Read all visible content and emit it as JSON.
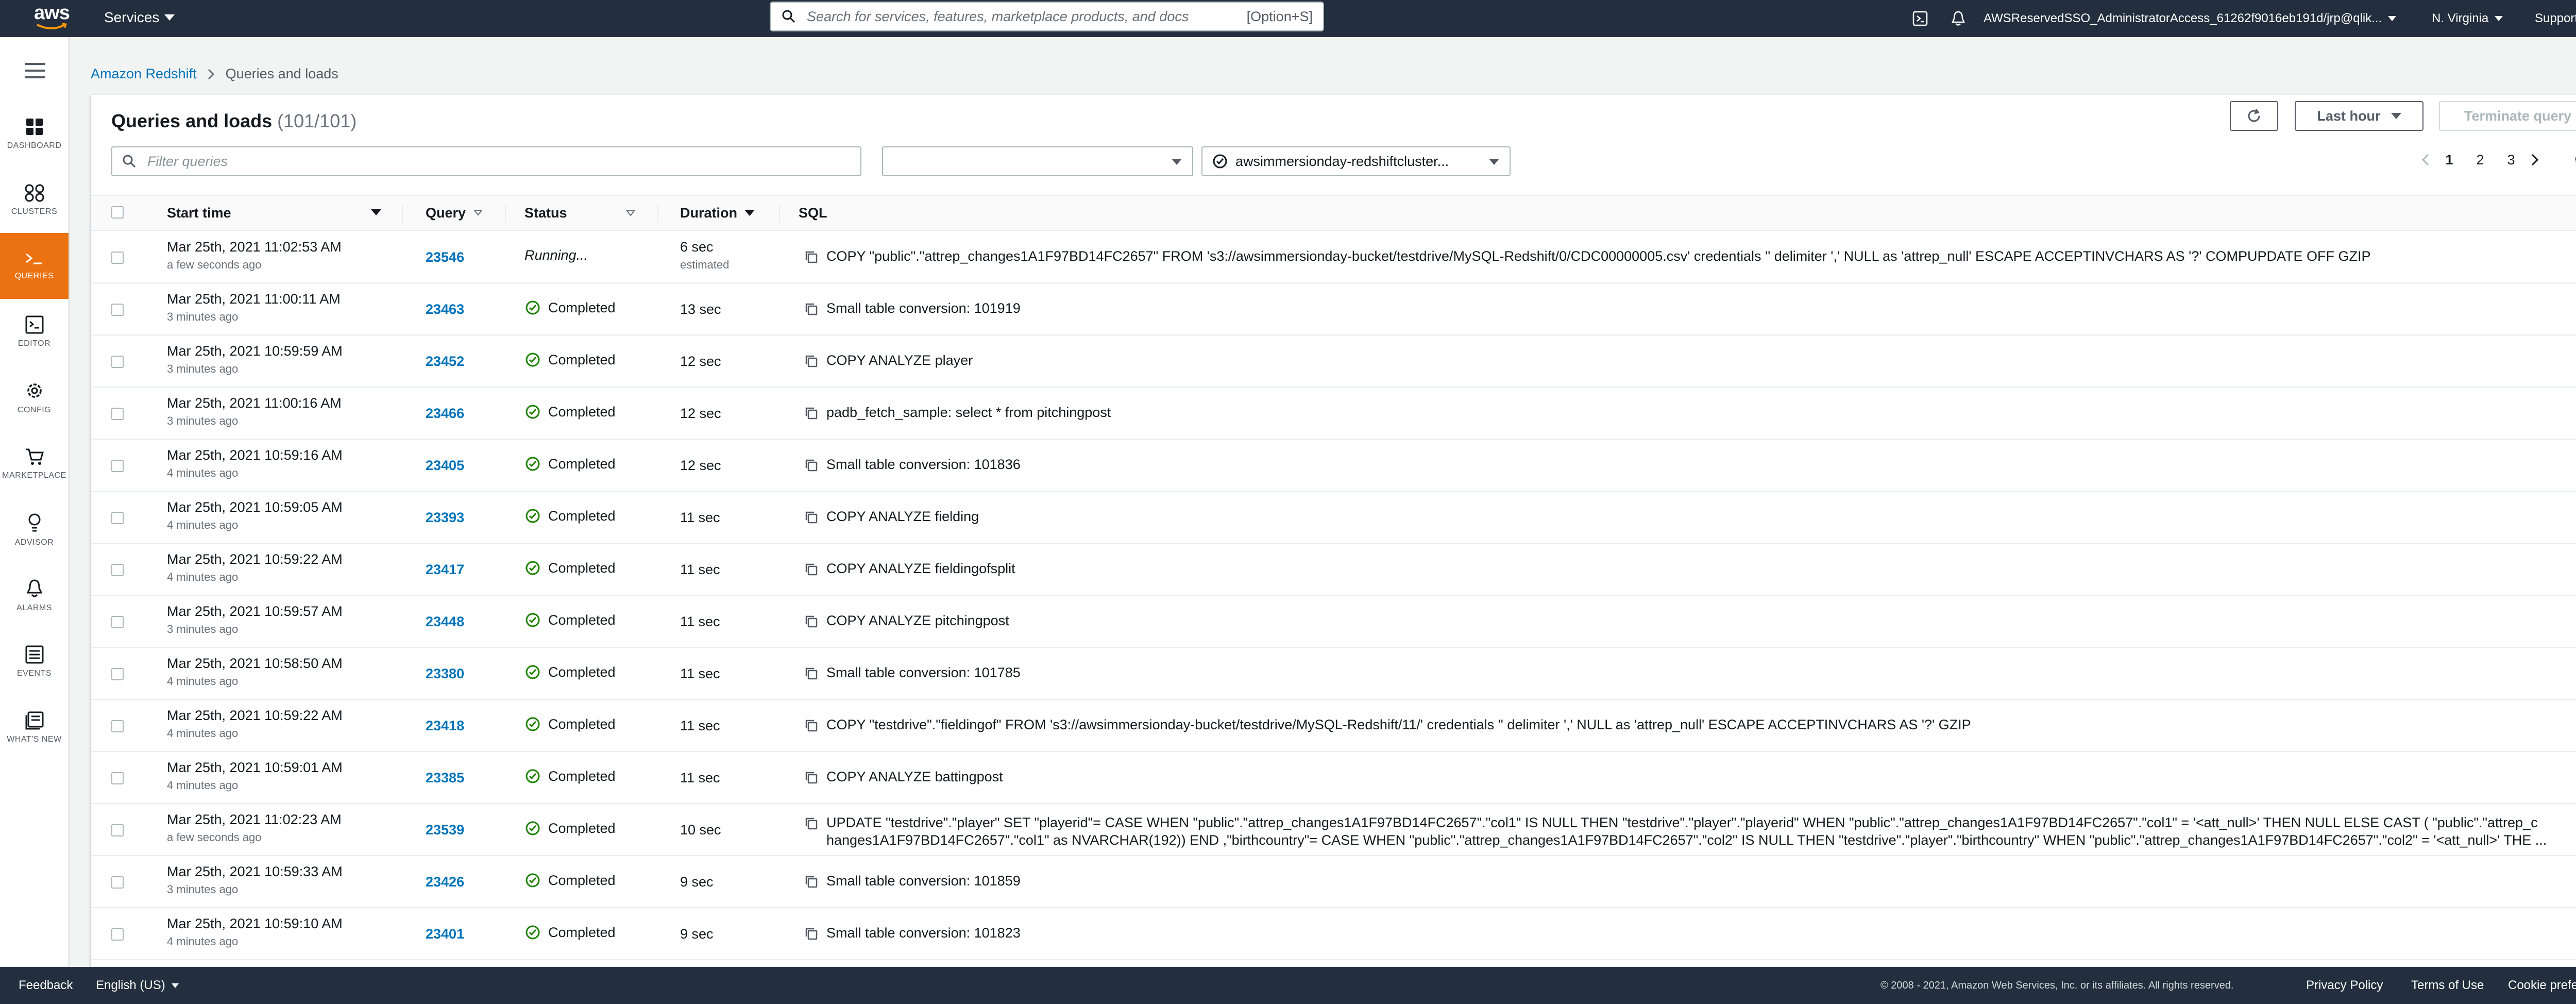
{
  "topnav": {
    "logo_text": "aws",
    "services_label": "Services",
    "search_placeholder": "Search for services, features, marketplace products, and docs",
    "search_shortcut": "[Option+S]",
    "account": "AWSReservedSSO_AdministratorAccess_61262f9016eb191d/jrp@qlik...",
    "region": "N. Virginia",
    "support": "Support"
  },
  "sidebar": {
    "items": [
      {
        "label": "DASHBOARD",
        "icon": "dashboard-icon"
      },
      {
        "label": "CLUSTERS",
        "icon": "clusters-icon"
      },
      {
        "label": "QUERIES",
        "icon": "queries-icon",
        "active": true
      },
      {
        "label": "EDITOR",
        "icon": "editor-icon"
      },
      {
        "label": "CONFIG",
        "icon": "config-gear-icon"
      },
      {
        "label": "MARKETPLACE",
        "icon": "marketplace-icon"
      },
      {
        "label": "ADVISOR",
        "icon": "advisor-lightbulb-icon"
      },
      {
        "label": "ALARMS",
        "icon": "alarms-bell-icon"
      },
      {
        "label": "EVENTS",
        "icon": "events-icon"
      },
      {
        "label": "WHAT'S NEW",
        "icon": "whats-new-icon"
      }
    ]
  },
  "breadcrumb": {
    "root": "Amazon Redshift",
    "current": "Queries and loads"
  },
  "panel": {
    "title": "Queries and loads",
    "count": "(101/101)",
    "time_range": "Last hour",
    "terminate_label": "Terminate query",
    "filter_placeholder": "Filter queries",
    "filter_select_value": "",
    "cluster_value": "awsimmersionday-redshiftcluster...",
    "pages": [
      "1",
      "2",
      "3"
    ],
    "current_page": "1"
  },
  "table": {
    "columns": {
      "start_time": "Start time",
      "query": "Query",
      "status": "Status",
      "duration": "Duration",
      "sql": "SQL"
    },
    "rows": [
      {
        "start": "Mar 25th, 2021 11:02:53 AM",
        "ago": "a few seconds ago",
        "query": "23546",
        "status": "Running...",
        "running": true,
        "duration": "6 sec",
        "duration_note": "estimated",
        "sql": "COPY \"public\".\"attrep_changes1A1F97BD14FC2657\" FROM 's3://awsimmersionday-bucket/testdrive/MySQL-Redshift/0/CDC00000005.csv' credentials '' delimiter ',' NULL as 'attrep_null' ESCAPE ACCEPTINVCHARS AS '?' COMPUPDATE OFF GZIP"
      },
      {
        "start": "Mar 25th, 2021 11:00:11 AM",
        "ago": "3 minutes ago",
        "query": "23463",
        "status": "Completed",
        "duration": "13 sec",
        "sql": "Small table conversion: 101919"
      },
      {
        "start": "Mar 25th, 2021 10:59:59 AM",
        "ago": "3 minutes ago",
        "query": "23452",
        "status": "Completed",
        "duration": "12 sec",
        "sql": "COPY ANALYZE player"
      },
      {
        "start": "Mar 25th, 2021 11:00:16 AM",
        "ago": "3 minutes ago",
        "query": "23466",
        "status": "Completed",
        "duration": "12 sec",
        "sql": "padb_fetch_sample: select * from pitchingpost"
      },
      {
        "start": "Mar 25th, 2021 10:59:16 AM",
        "ago": "4 minutes ago",
        "query": "23405",
        "status": "Completed",
        "duration": "12 sec",
        "sql": "Small table conversion: 101836"
      },
      {
        "start": "Mar 25th, 2021 10:59:05 AM",
        "ago": "4 minutes ago",
        "query": "23393",
        "status": "Completed",
        "duration": "11 sec",
        "sql": "COPY ANALYZE fielding"
      },
      {
        "start": "Mar 25th, 2021 10:59:22 AM",
        "ago": "4 minutes ago",
        "query": "23417",
        "status": "Completed",
        "duration": "11 sec",
        "sql": "COPY ANALYZE fieldingofsplit"
      },
      {
        "start": "Mar 25th, 2021 10:59:57 AM",
        "ago": "3 minutes ago",
        "query": "23448",
        "status": "Completed",
        "duration": "11 sec",
        "sql": "COPY ANALYZE pitchingpost"
      },
      {
        "start": "Mar 25th, 2021 10:58:50 AM",
        "ago": "4 minutes ago",
        "query": "23380",
        "status": "Completed",
        "duration": "11 sec",
        "sql": "Small table conversion: 101785"
      },
      {
        "start": "Mar 25th, 2021 10:59:22 AM",
        "ago": "4 minutes ago",
        "query": "23418",
        "status": "Completed",
        "duration": "11 sec",
        "sql": "COPY \"testdrive\".\"fieldingof\" FROM 's3://awsimmersionday-bucket/testdrive/MySQL-Redshift/11/' credentials '' delimiter ',' NULL as 'attrep_null' ESCAPE ACCEPTINVCHARS AS '?' GZIP"
      },
      {
        "start": "Mar 25th, 2021 10:59:01 AM",
        "ago": "4 minutes ago",
        "query": "23385",
        "status": "Completed",
        "duration": "11 sec",
        "sql": "COPY ANALYZE battingpost"
      },
      {
        "start": "Mar 25th, 2021 11:02:23 AM",
        "ago": "a few seconds ago",
        "query": "23539",
        "status": "Completed",
        "duration": "10 sec",
        "sql": "UPDATE \"testdrive\".\"player\" SET \"playerid\"= CASE WHEN \"public\".\"attrep_changes1A1F97BD14FC2657\".\"col1\" IS NULL THEN \"testdrive\".\"player\".\"playerid\" WHEN \"public\".\"attrep_changes1A1F97BD14FC2657\".\"col1\" = '<att_null>' THEN NULL ELSE CAST ( \"public\".\"attrep_c",
        "sql2": "hanges1A1F97BD14FC2657\".\"col1\" as NVARCHAR(192)) END ,\"birthcountry\"= CASE WHEN \"public\".\"attrep_changes1A1F97BD14FC2657\".\"col2\" IS NULL THEN \"testdrive\".\"player\".\"birthcountry\" WHEN \"public\".\"attrep_changes1A1F97BD14FC2657\".\"col2\" = '<att_null>' THE ..."
      },
      {
        "start": "Mar 25th, 2021 10:59:33 AM",
        "ago": "3 minutes ago",
        "query": "23426",
        "status": "Completed",
        "duration": "9 sec",
        "sql": "Small table conversion: 101859"
      },
      {
        "start": "Mar 25th, 2021 10:59:10 AM",
        "ago": "4 minutes ago",
        "query": "23401",
        "status": "Completed",
        "duration": "9 sec",
        "sql": "Small table conversion: 101823"
      }
    ]
  },
  "footer": {
    "feedback": "Feedback",
    "language": "English (US)",
    "copyright": "© 2008 - 2021, Amazon Web Services, Inc. or its affiliates. All rights reserved.",
    "privacy": "Privacy Policy",
    "terms": "Terms of Use",
    "cookies": "Cookie preferences"
  },
  "colors": {
    "nav_bg": "#232f3e",
    "accent_orange": "#ec7211",
    "link_blue": "#0073bb",
    "success_green": "#1d8102"
  }
}
